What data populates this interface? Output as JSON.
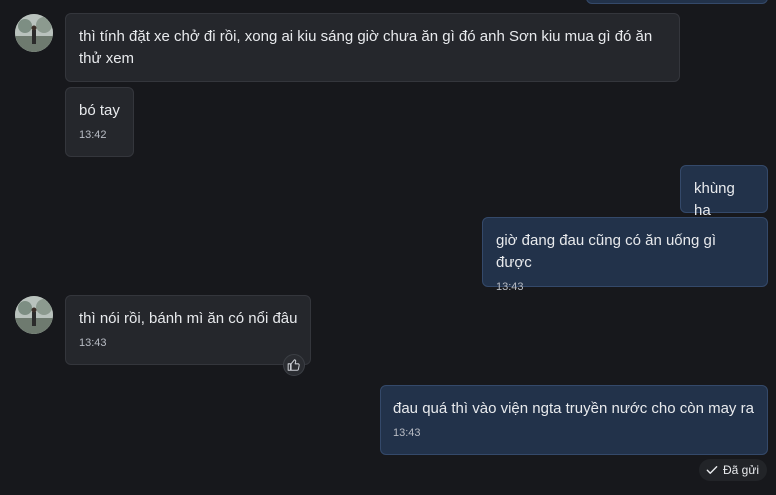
{
  "messages": [
    {
      "dir": "in",
      "text": "thì tính đặt xe chở đi rồi, xong ai kiu sáng giờ chưa ăn gì đó anh Sơn kiu mua gì đó ăn thử xem",
      "time": ""
    },
    {
      "dir": "in",
      "text": "bó tay",
      "time": "13:42"
    },
    {
      "dir": "out",
      "text": "khùng ha",
      "time": ""
    },
    {
      "dir": "out",
      "text": "giờ đang đau cũng có ăn uống gì được",
      "time": "13:43"
    },
    {
      "dir": "in",
      "text": "thì nói rồi, bánh mì ăn có nổi đâu",
      "time": "13:43"
    },
    {
      "dir": "out",
      "text": "đau quá thì vào viện ngta truyền nước cho còn may ra",
      "time": "13:43"
    }
  ],
  "status": {
    "label": "Đã gửi"
  },
  "icons": {
    "avatar": "avatar-photo",
    "reaction": "thumbs-up-icon",
    "sent": "check-icon"
  },
  "colors": {
    "background": "#17181c",
    "incoming_bubble": "#25272c",
    "outgoing_bubble": "#22324a",
    "text": "#e8eaed"
  }
}
